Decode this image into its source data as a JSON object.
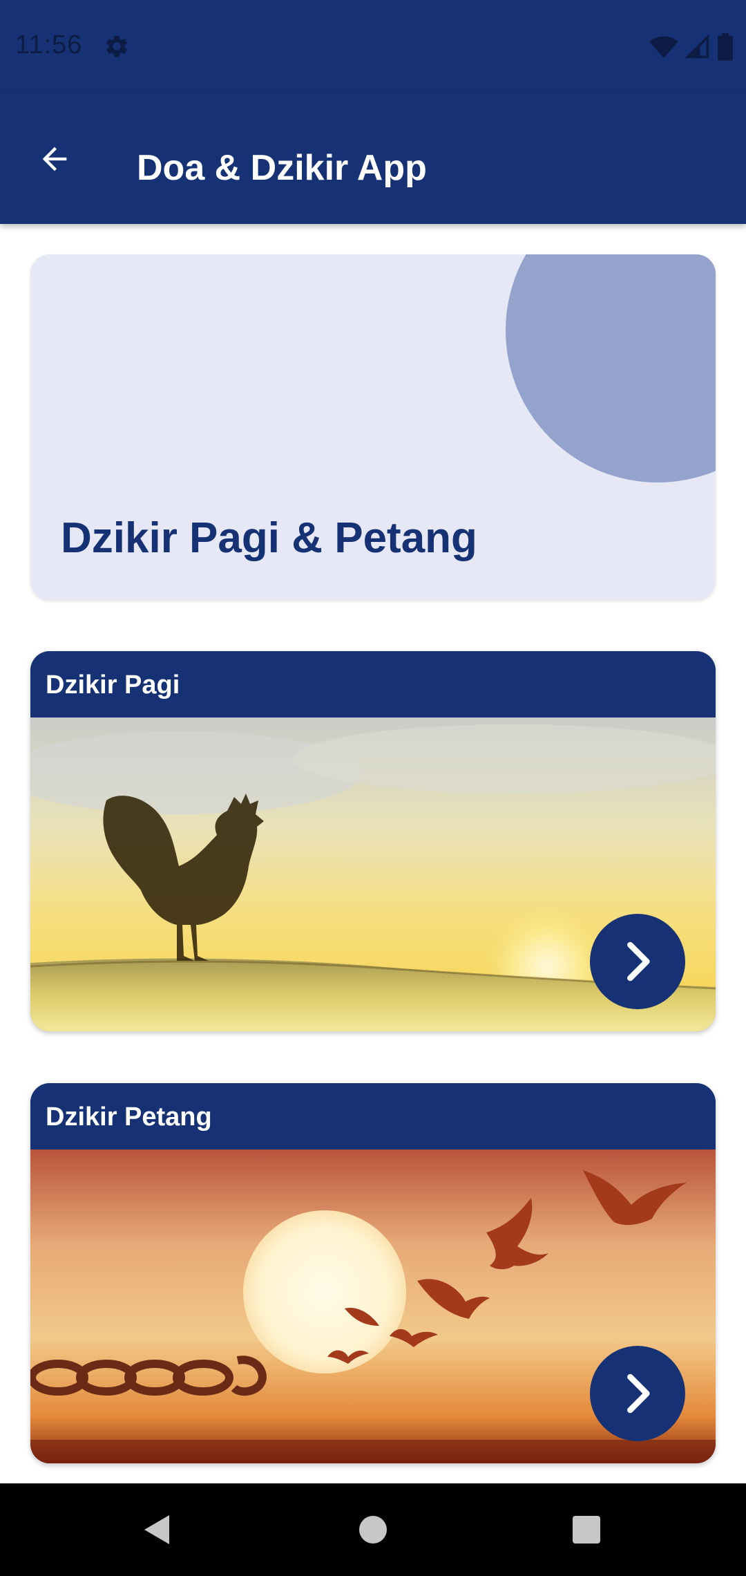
{
  "status_bar": {
    "time": "11:56",
    "icons": [
      "settings-icon",
      "wifi-icon",
      "signal-icon",
      "battery-icon"
    ]
  },
  "toolbar": {
    "title": "Doa & Dzikir App",
    "back_icon": "arrow-back-icon"
  },
  "header_card": {
    "title": "Dzikir Pagi & Petang"
  },
  "cards": [
    {
      "title": "Dzikir Pagi",
      "image": "sunrise-rooster-silhouette",
      "button_icon": "chevron-right-icon"
    },
    {
      "title": "Dzikir Petang",
      "image": "sunset-birds-broken-chain",
      "button_icon": "chevron-right-icon"
    }
  ],
  "nav_bar": {
    "buttons": [
      "back-triangle-icon",
      "home-circle-icon",
      "recents-square-icon"
    ]
  },
  "colors": {
    "primary": "#163274",
    "header_card_bg": "#e6e8f5",
    "header_circle": "#93a3cb",
    "white": "#ffffff"
  }
}
